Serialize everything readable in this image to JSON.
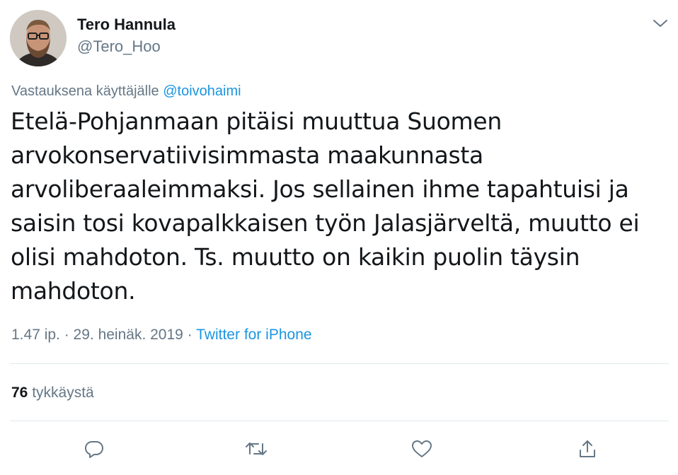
{
  "author": {
    "name": "Tero Hannula",
    "handle": "@Tero_Hoo"
  },
  "reply_context": {
    "prefix": "Vastauksena käyttäjälle",
    "mention": "@toivohaimi"
  },
  "tweet": {
    "text_lines": [
      "Etelä-Pohjanmaan pitäisi muuttua Suomen",
      "arvokonservatiivisimmasta maakunnasta",
      "arvoliberaaleimmaksi. Jos sellainen ihme tapahtuisi ja",
      "saisin tosi kovapalkkaisen työn Jalasjärveltä, muutto ei",
      "olisi mahdoton. Ts. muutto on kaikin puolin täysin",
      "mahdoton."
    ],
    "timestamp": "1.47 ip. · 29. heinäk. 2019 ·",
    "source": "Twitter for iPhone"
  },
  "stats": {
    "likes_count": "76",
    "likes_label": "tykkäystä"
  },
  "actions": {
    "reply_icon": "reply-icon",
    "retweet_icon": "retweet-icon",
    "like_icon": "heart-icon",
    "share_icon": "share-icon"
  },
  "colors": {
    "text": "#14171a",
    "secondary": "#657786",
    "link": "#1b95e0",
    "divider": "#e1e8ed"
  }
}
